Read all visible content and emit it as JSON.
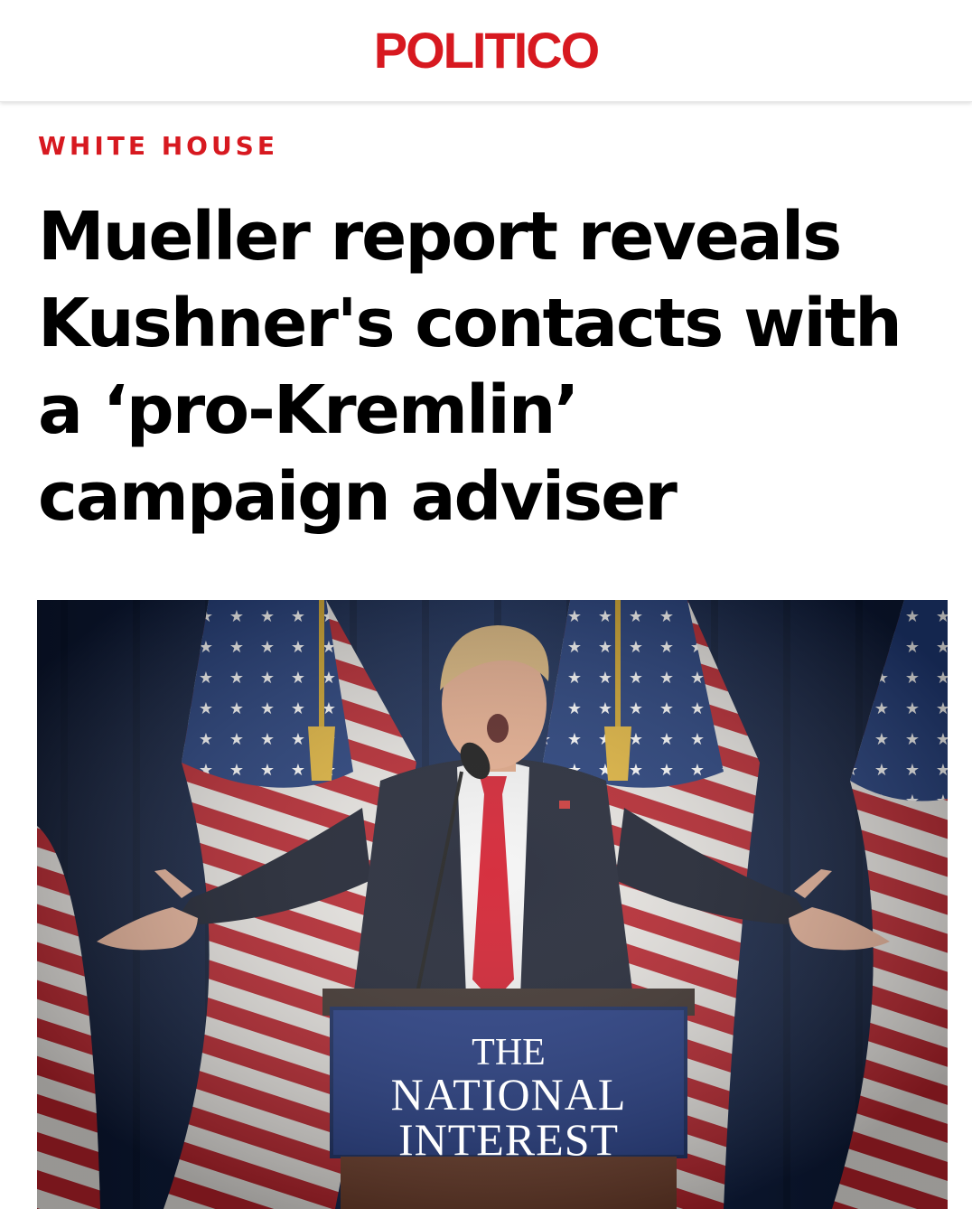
{
  "header": {
    "logo": "POLITICO"
  },
  "article": {
    "section": "WHITE HOUSE",
    "headline": "Mueller report reveals Kushner's contacts with a ‘pro-Kremlin’ campaign adviser"
  },
  "image": {
    "podium_sign": {
      "line1": "THE",
      "line2": "NATIONAL",
      "line3": "INTEREST"
    }
  },
  "colors": {
    "brand_red": "#d71920",
    "headline": "#000000",
    "podium_blue": "#1a3a8a"
  }
}
